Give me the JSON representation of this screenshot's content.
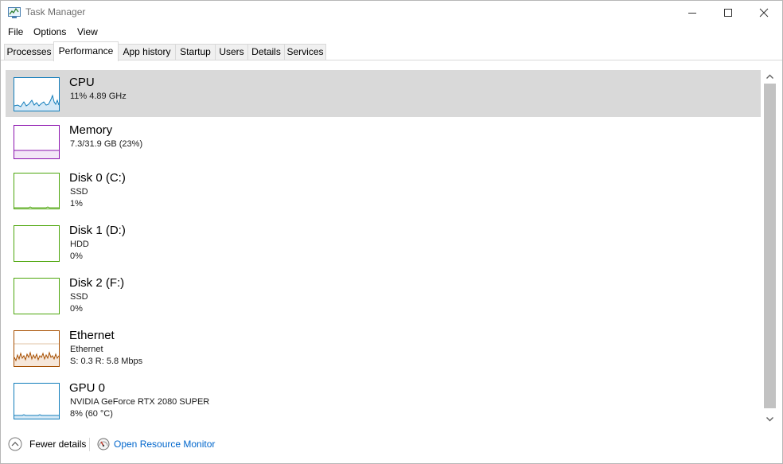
{
  "window": {
    "title": "Task Manager"
  },
  "menu": [
    "File",
    "Options",
    "View"
  ],
  "tabs": [
    {
      "label": "Processes",
      "active": false
    },
    {
      "label": "Performance",
      "active": true
    },
    {
      "label": "App history",
      "active": false
    },
    {
      "label": "Startup",
      "active": false
    },
    {
      "label": "Users",
      "active": false
    },
    {
      "label": "Details",
      "active": false
    },
    {
      "label": "Services",
      "active": false
    }
  ],
  "resources": [
    {
      "name": "CPU",
      "lines": [
        "11%  4.89 GHz"
      ],
      "color": "#117dbb",
      "selected": true
    },
    {
      "name": "Memory",
      "lines": [
        "7.3/31.9 GB (23%)"
      ],
      "color": "#8b12ae",
      "selected": false
    },
    {
      "name": "Disk 0 (C:)",
      "lines": [
        "SSD",
        "1%"
      ],
      "color": "#4da60c",
      "selected": false
    },
    {
      "name": "Disk 1 (D:)",
      "lines": [
        "HDD",
        "0%"
      ],
      "color": "#4da60c",
      "selected": false
    },
    {
      "name": "Disk 2 (F:)",
      "lines": [
        "SSD",
        "0%"
      ],
      "color": "#4da60c",
      "selected": false
    },
    {
      "name": "Ethernet",
      "lines": [
        "Ethernet",
        "S: 0.3  R: 5.8 Mbps"
      ],
      "color": "#a74f01",
      "selected": false
    },
    {
      "name": "GPU 0",
      "lines": [
        "NVIDIA GeForce RTX 2080 SUPER",
        "8%  (60 °C)"
      ],
      "color": "#117dbb",
      "selected": false
    }
  ],
  "footer": {
    "fewer_details": "Fewer details",
    "open_resource_monitor": "Open Resource Monitor"
  },
  "icons": {
    "app": "task-manager-icon",
    "minimize": "minimize-icon",
    "maximize": "maximize-icon",
    "close": "close-icon",
    "fewer_details": "chevron-up-circle-icon",
    "resource_monitor": "resource-monitor-icon",
    "scroll_up": "chevron-up-icon",
    "scroll_down": "chevron-down-icon"
  }
}
